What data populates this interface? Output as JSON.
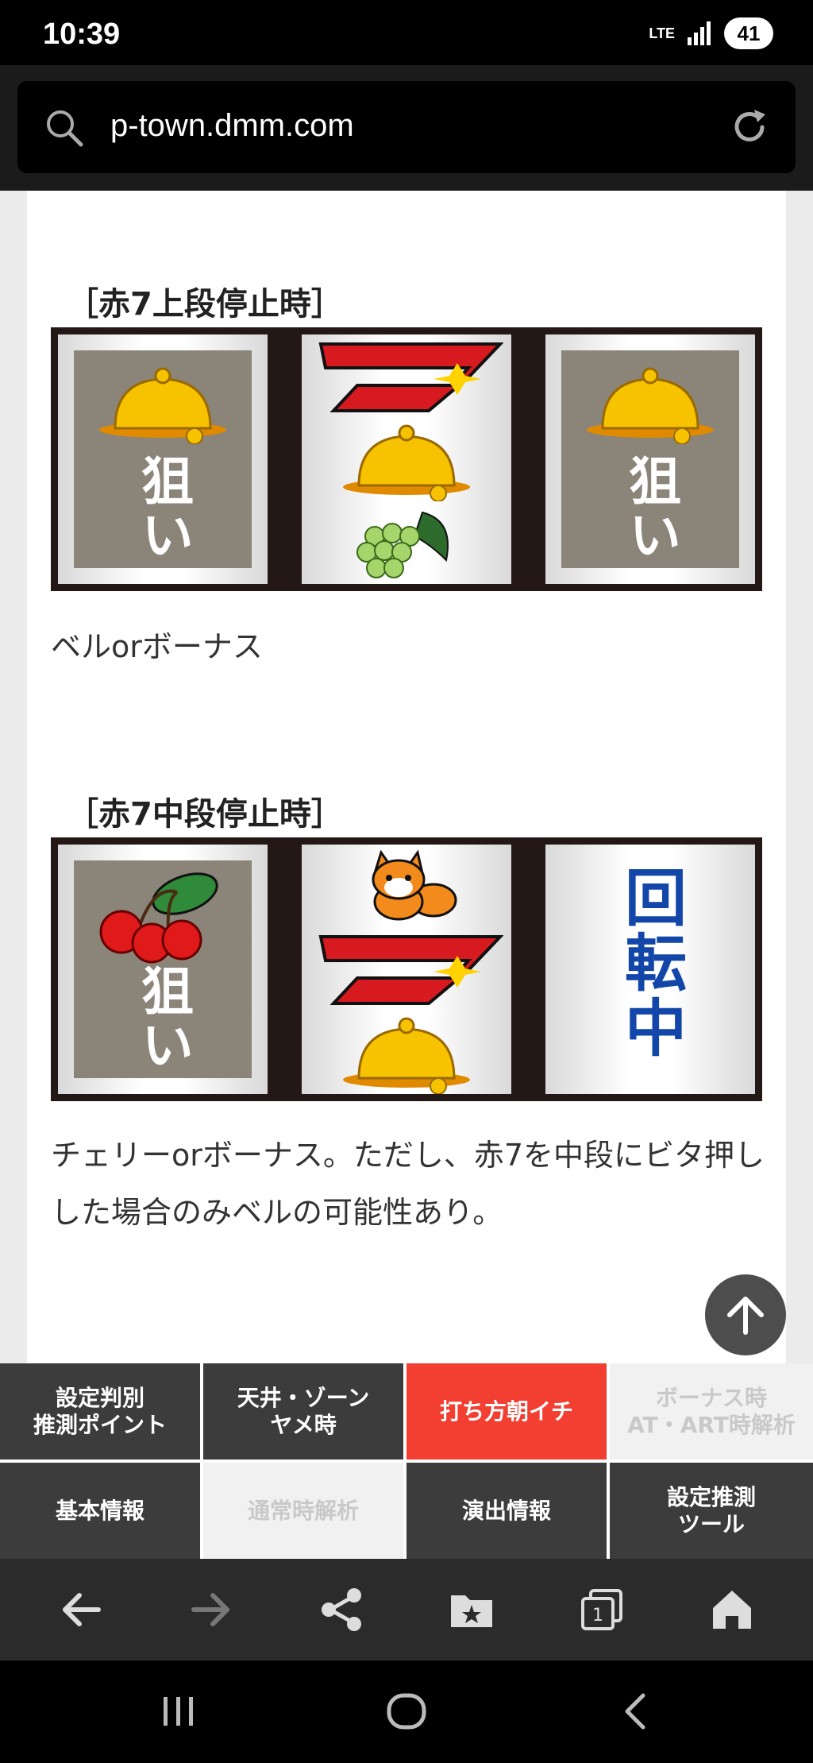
{
  "status": {
    "time": "10:39",
    "network": "LTE",
    "battery": "41"
  },
  "browser": {
    "url": "p-town.dmm.com"
  },
  "sections": [
    {
      "title": "［赤7上段停止時］",
      "reel1_label": "狙い",
      "reel3_label": "狙い",
      "description": "ベルorボーナス"
    },
    {
      "title": "［赤7中段停止時］",
      "reel1_label": "狙い",
      "reel3_label": "回転中",
      "description": "チェリーorボーナス。ただし、赤7を中段にビタ押しした場合のみベルの可能性あり。"
    }
  ],
  "tabs": {
    "row1": [
      "設定判別\n推測ポイント",
      "天井・ゾーン\nヤメ時",
      "打ち方朝イチ",
      "ボーナス時\nAT・ART時解析"
    ],
    "row2": [
      "基本情報",
      "通常時解析",
      "演出情報",
      "設定推測\nツール"
    ]
  },
  "colors": {
    "accent": "#f33e32",
    "tab_bg": "#3c3c3c",
    "disabled_tab": "#f1f1f1",
    "spin_text": "#1246a8",
    "target_bg": "#8a8479"
  }
}
